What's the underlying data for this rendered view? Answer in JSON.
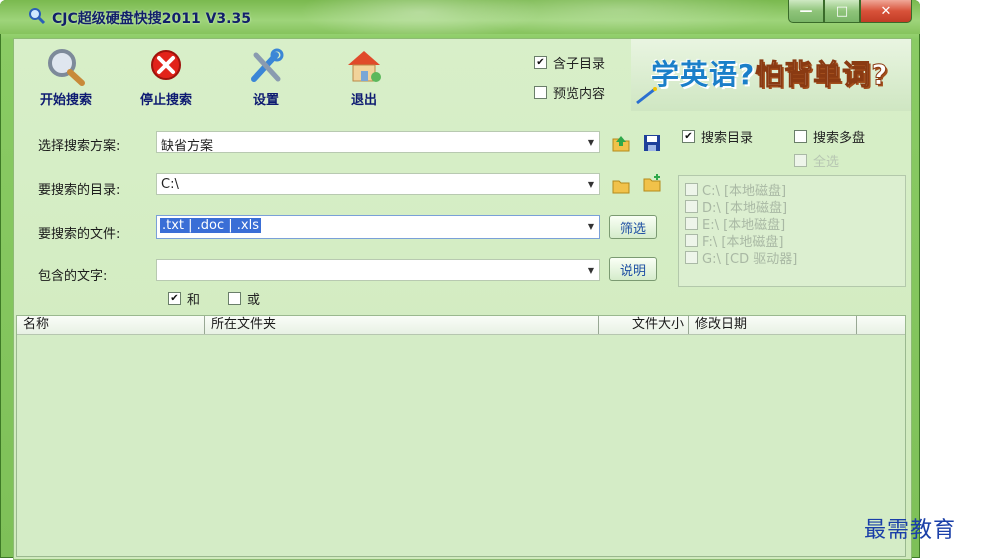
{
  "window": {
    "title": "CJC超级硬盘快搜2011 V3.35",
    "buttons": {
      "minimize": "—",
      "maximize": "□",
      "close": "✕"
    }
  },
  "toolbar": {
    "start_search": "开始搜索",
    "stop_search": "停止搜索",
    "settings": "设置",
    "exit": "退出"
  },
  "options": {
    "include_subdirs": {
      "label": "含子目录",
      "checked": true
    },
    "preview_content": {
      "label": "预览内容",
      "checked": false
    }
  },
  "banner": {
    "part1": "学英语?",
    "part2": "怕背单词?"
  },
  "form": {
    "scheme": {
      "label": "选择搜索方案:",
      "value": "缺省方案"
    },
    "directory": {
      "label": "要搜索的目录:",
      "value": "C:\\"
    },
    "files": {
      "label": "要搜索的文件:",
      "value": ".txt | .doc | .xls",
      "button": "筛选"
    },
    "text": {
      "label": "包含的文字:",
      "value": "",
      "button": "说明"
    },
    "and": {
      "label": "和",
      "checked": true
    },
    "or": {
      "label": "或",
      "checked": false
    }
  },
  "right_panel": {
    "search_dir": {
      "label": "搜索目录",
      "checked": true
    },
    "search_multi": {
      "label": "搜索多盘",
      "checked": false
    },
    "select_all": {
      "label": "全选",
      "checked": false
    },
    "drives": [
      "C:\\ [本地磁盘]",
      "D:\\ [本地磁盘]",
      "E:\\ [本地磁盘]",
      "F:\\ [本地磁盘]",
      "G:\\ [CD 驱动器]"
    ]
  },
  "results": {
    "columns": [
      "名称",
      "所在文件夹",
      "文件大小",
      "修改日期"
    ]
  },
  "watermark": "最需教育",
  "colors": {
    "accent": "#7cc054",
    "title_text": "#12206a",
    "selection": "#3a6ed6"
  }
}
